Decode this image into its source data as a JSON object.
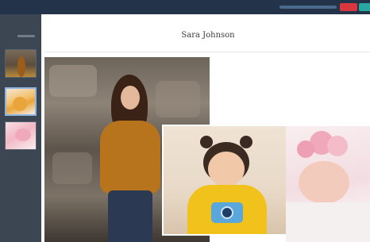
{
  "app": {
    "title": "",
    "user_label": "",
    "red_button_label": "",
    "teal_button_label": ""
  },
  "sidebar": {
    "label": "",
    "sublabel": ""
  },
  "page": {
    "pager_text": "",
    "heading": "Sara Johnson",
    "text_line1": "",
    "text_paragraph": "",
    "text_line3": ""
  },
  "colors": {
    "topbar": "#23344a",
    "sidebar": "#3b4652",
    "danger_button": "#d9363e",
    "accent_button": "#2aa7a0",
    "selected_thumb_border": "#8fb6e0"
  },
  "icons": {
    "thumb1": "portrait-photo",
    "thumb2": "child-photo",
    "thumb3": "baby-photo"
  }
}
